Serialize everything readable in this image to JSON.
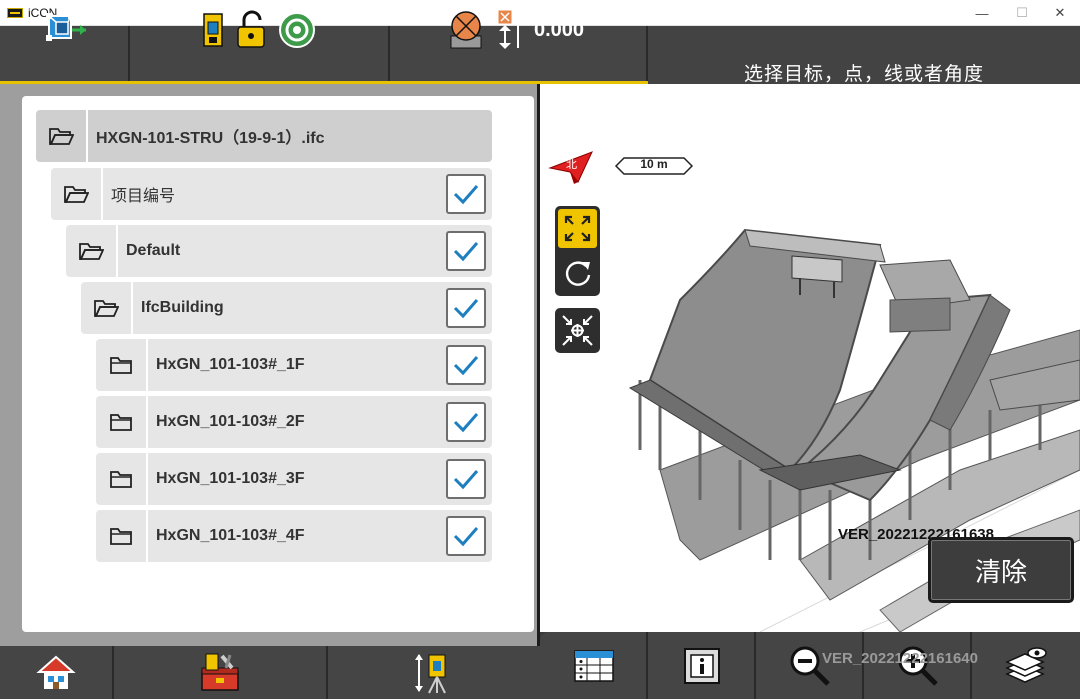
{
  "window": {
    "title": "iCON",
    "minimize_glyph": "—",
    "maximize_glyph": "☐",
    "close_glyph": "✕"
  },
  "toolbar": {
    "height_value": "0.000",
    "icons": [
      "model-layers-icon",
      "instrument-icon",
      "unlock-icon",
      "target-icon",
      "prism-icon",
      "height-arrow-icon"
    ]
  },
  "prompt": {
    "text": "选择目标，点，线或者角度"
  },
  "layer_tree": {
    "root": {
      "label": "HXGN-101-STRU（19-9-1）.ifc"
    },
    "items": [
      {
        "label": "项目编号",
        "checked": true
      },
      {
        "label": "Default",
        "checked": true
      },
      {
        "label": "IfcBuilding",
        "checked": true
      },
      {
        "label": "HxGN_101-103#_1F",
        "checked": true
      },
      {
        "label": "HxGN_101-103#_2F",
        "checked": true
      },
      {
        "label": "HxGN_101-103#_3F",
        "checked": true
      },
      {
        "label": "HxGN_101-103#_4F",
        "checked": true
      }
    ]
  },
  "viewport": {
    "north_label": "北",
    "scale_label": "10 m",
    "model_label": "VER_20221222161638",
    "ghost_label": "VER_20221222161640",
    "clear_button_label": "清除"
  },
  "bottom_bar": {
    "left_icons": [
      "home-icon",
      "toolbox-icon",
      "instrument-setup-icon"
    ],
    "right_icons": [
      "table-icon",
      "info-icon",
      "zoom-out-icon",
      "zoom-in-icon",
      "layers-icon"
    ]
  },
  "colors": {
    "accent": "#f1c400",
    "toolbar": "#454545",
    "check": "#1e7fc0"
  }
}
